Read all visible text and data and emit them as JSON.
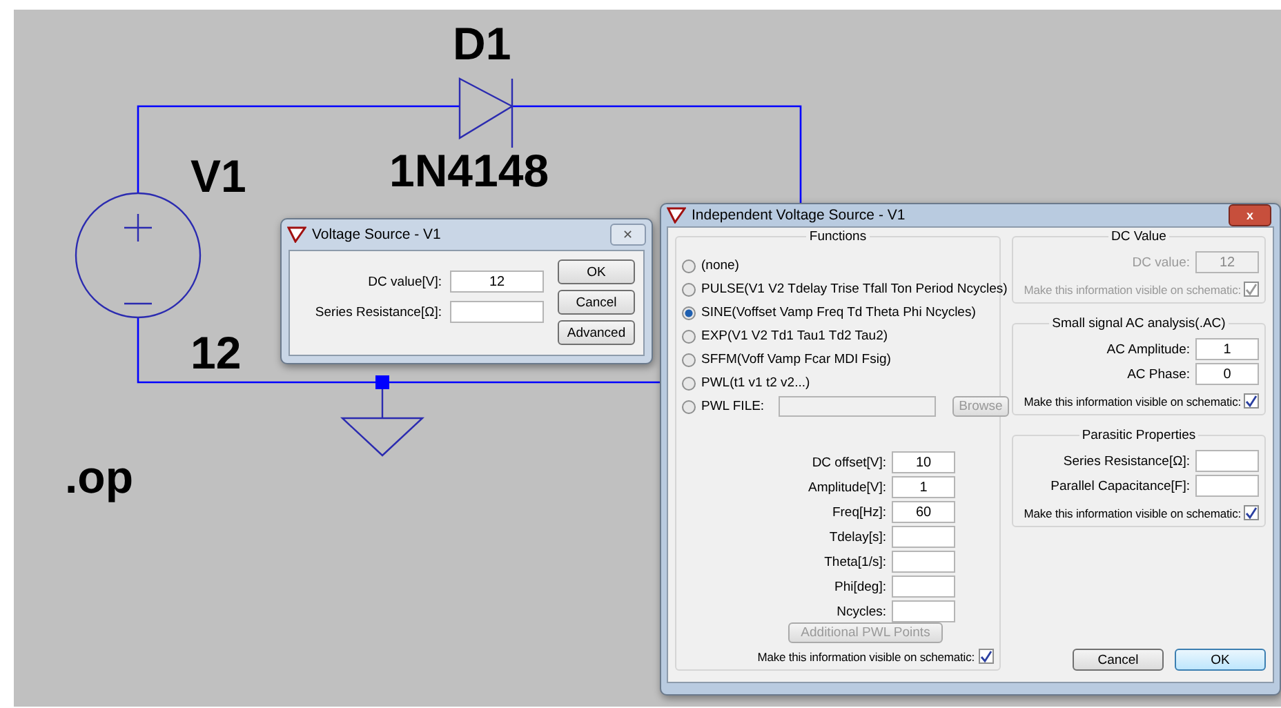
{
  "schematic": {
    "diode_ref": "D1",
    "diode_value": "1N4148",
    "source_ref": "V1",
    "source_value": "12",
    "directive": ".op"
  },
  "voltage_dialog": {
    "title": "Voltage Source - V1",
    "close": "✕",
    "fields": [
      {
        "label": "DC value[V]:",
        "value": "12"
      },
      {
        "label": "Series Resistance[Ω]:"
      }
    ],
    "buttons": [
      "OK",
      "Cancel",
      "Advanced"
    ]
  },
  "source_dialog": {
    "title": "Independent Voltage Source - V1",
    "close": "x",
    "functions": {
      "title": "Functions",
      "options": [
        {
          "kind": "radio",
          "label": "(none)",
          "selected": false
        },
        {
          "kind": "radio",
          "label": "PULSE(V1 V2 Tdelay Trise Tfall Ton Period Ncycles)",
          "selected": false
        },
        {
          "kind": "radio",
          "label": "SINE(Voffset Vamp Freq Td Theta Phi Ncycles)",
          "selected": true
        },
        {
          "kind": "radio",
          "label": "EXP(V1 V2 Td1 Tau1 Td2 Tau2)",
          "selected": false
        },
        {
          "kind": "radio",
          "label": "SFFM(Voff Vamp Fcar MDI Fsig)",
          "selected": false
        },
        {
          "kind": "radio",
          "label": "PWL(t1 v1 t2 v2...)",
          "selected": false
        },
        {
          "kind": "file",
          "label": "PWL FILE:",
          "selected": false,
          "button": "Browse",
          "disabled": true
        }
      ],
      "parameters": [
        {
          "label": "DC offset[V]:",
          "value": "10"
        },
        {
          "label": "Amplitude[V]:",
          "value": "1"
        },
        {
          "label": "Freq[Hz]:",
          "value": "60"
        },
        {
          "label": "Tdelay[s]:"
        },
        {
          "label": "Theta[1/s]:"
        },
        {
          "label": "Phi[deg]:"
        },
        {
          "label": "Ncycles:"
        }
      ],
      "extra_button": {
        "label": "Additional PWL Points",
        "disabled": true
      },
      "visible": {
        "label": "Make this information visible on schematic:",
        "checked": true
      }
    },
    "dc_value": {
      "title": "DC Value",
      "disabled": true,
      "fields": [
        {
          "label": "DC value:",
          "value": "12"
        }
      ],
      "visible": {
        "label": "Make this information visible on schematic:",
        "checked": true
      }
    },
    "ac_analysis": {
      "title": "Small signal AC analysis(.AC)",
      "disabled": false,
      "fields": [
        {
          "label": "AC Amplitude:",
          "value": "1"
        },
        {
          "label": "AC Phase:",
          "value": "0"
        }
      ],
      "visible": {
        "label": "Make this information visible on schematic:",
        "checked": true
      }
    },
    "parasitic": {
      "title": "Parasitic Properties",
      "disabled": false,
      "fields": [
        {
          "label": "Series Resistance[Ω]:"
        },
        {
          "label": "Parallel Capacitance[F]:"
        }
      ],
      "visible": {
        "label": "Make this information visible on schematic:",
        "checked": true
      }
    },
    "buttons": [
      {
        "label": "Cancel",
        "default": false
      },
      {
        "label": "OK",
        "default": true
      }
    ]
  }
}
